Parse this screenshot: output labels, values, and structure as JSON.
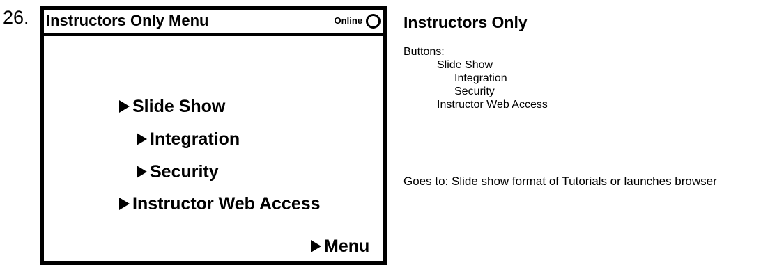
{
  "slide_number": "26.",
  "screen": {
    "title": "Instructors Only Menu",
    "status_label": "Online",
    "menu_items": [
      {
        "label": "Slide Show"
      },
      {
        "label": "Integration"
      },
      {
        "label": "Security"
      },
      {
        "label": "Instructor Web Access"
      }
    ],
    "menu_button_label": "Menu"
  },
  "info": {
    "title": "Instructors Only",
    "buttons_heading": "Buttons:",
    "button_list": [
      "Slide Show",
      "Integration",
      "Security",
      "Instructor Web Access"
    ],
    "goes_to": "Goes to: Slide show format of Tutorials or launches browser"
  }
}
